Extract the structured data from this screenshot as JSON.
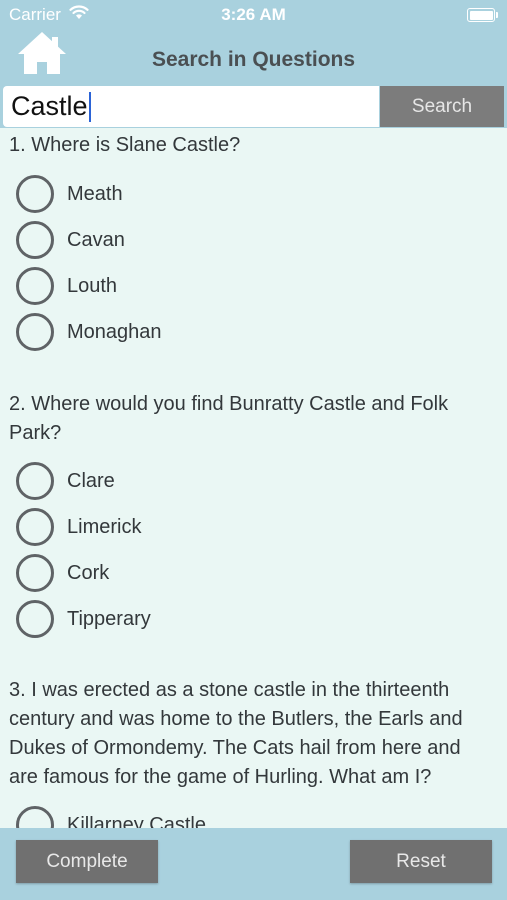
{
  "status_bar": {
    "carrier": "Carrier",
    "time": "3:26 AM",
    "wifi_icon": "wifi-icon",
    "battery_icon": "battery-icon",
    "battery_level": 1.0
  },
  "nav": {
    "home_icon": "home-icon",
    "title": "Search in Questions"
  },
  "search": {
    "value": "Castle",
    "button_label": "Search"
  },
  "questions": [
    {
      "text": "1. Where is Slane Castle?",
      "options": [
        "Meath",
        "Cavan",
        "Louth",
        "Monaghan"
      ]
    },
    {
      "text": "2. Where would you find Bunratty Castle and Folk Park?",
      "options": [
        "Clare",
        "Limerick",
        "Cork",
        "Tipperary"
      ]
    },
    {
      "text": "3. I was erected as a stone castle in the thirteenth century and was home to the Butlers, the Earls and Dukes of Ormondemy. The Cats hail from here and are famous for the game of Hurling. What am I?",
      "options": [
        "Killarney Castle"
      ]
    }
  ],
  "footer": {
    "complete_label": "Complete",
    "reset_label": "Reset"
  },
  "colors": {
    "header_bg": "#a9d1de",
    "content_bg": "#eaf7f4",
    "button_gray": "#707070",
    "caret_blue": "#2b63d6"
  }
}
